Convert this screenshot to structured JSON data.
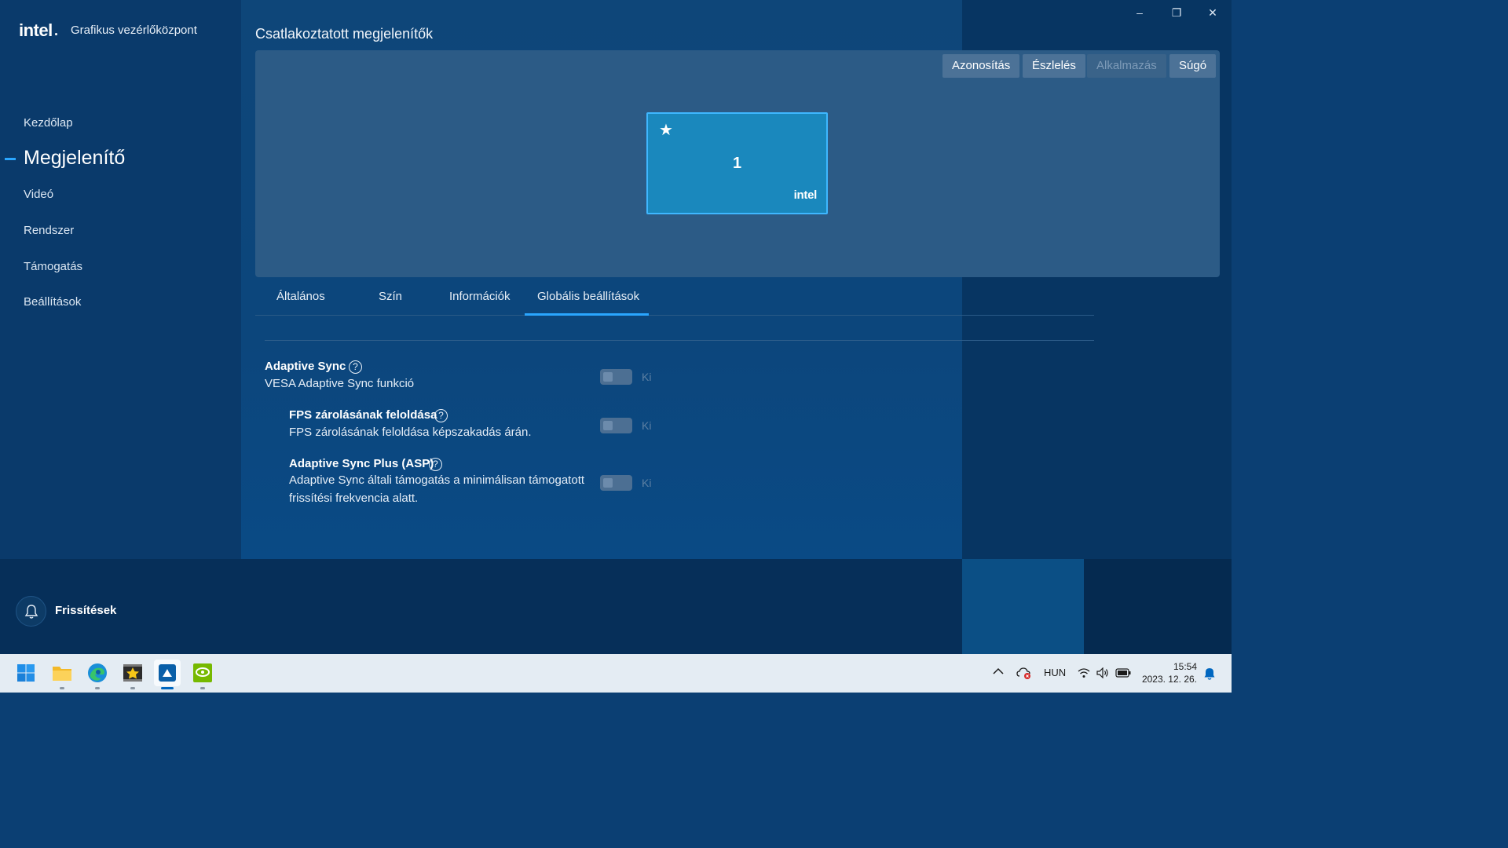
{
  "window": {
    "minimize_glyph": "–",
    "restore_glyph": "❐",
    "close_glyph": "✕"
  },
  "header": {
    "logo_text": "intel",
    "app_title": "Grafikus vezérlőközpont"
  },
  "sidebar": {
    "items": [
      {
        "label": "Kezdőlap",
        "active": false
      },
      {
        "label": "Megjelenítő",
        "active": true
      },
      {
        "label": "Videó",
        "active": false
      },
      {
        "label": "Rendszer",
        "active": false
      },
      {
        "label": "Támogatás",
        "active": false
      },
      {
        "label": "Beállítások",
        "active": false
      }
    ],
    "updates_label": "Frissítések",
    "bell_icon": "bell-icon"
  },
  "main": {
    "section_title": "Csatlakoztatott megjelenítők",
    "toolbar": {
      "identify": "Azonosítás",
      "detect": "Észlelés",
      "apply": "Alkalmazás",
      "help": "Súgó"
    },
    "monitor": {
      "star": "★",
      "number": "1",
      "brand": "intel"
    },
    "tabs": [
      {
        "label": "Általános",
        "active": false
      },
      {
        "label": "Szín",
        "active": false
      },
      {
        "label": "Információk",
        "active": false
      },
      {
        "label": "Globális beállítások",
        "active": true
      }
    ],
    "settings": [
      {
        "title": "Adaptive Sync",
        "desc": "VESA Adaptive Sync funkció",
        "state": "Ki",
        "enabled": false
      },
      {
        "title": "FPS zárolásának feloldása",
        "desc": "FPS zárolásának feloldása képszakadás árán.",
        "state": "Ki",
        "enabled": false
      },
      {
        "title": "Adaptive Sync Plus (ASP)",
        "desc_line1": "Adaptive Sync általi támogatás a minimálisan támogatott",
        "desc_line2": "frissítési frekvencia alatt.",
        "state": "Ki",
        "enabled": false
      }
    ],
    "help_glyph": "?"
  },
  "taskbar": {
    "apps": [
      "windows-start-icon",
      "file-explorer-icon",
      "edge-icon",
      "movie-maker-icon",
      "intel-graphics-icon",
      "nvidia-icon"
    ],
    "tray": {
      "language": "HUN",
      "time": "15:54",
      "date": "2023. 12. 26."
    }
  },
  "colors": {
    "accent": "#2aa6ff",
    "monitor_fill": "#1a88bd",
    "panel": "#2c5b86"
  }
}
